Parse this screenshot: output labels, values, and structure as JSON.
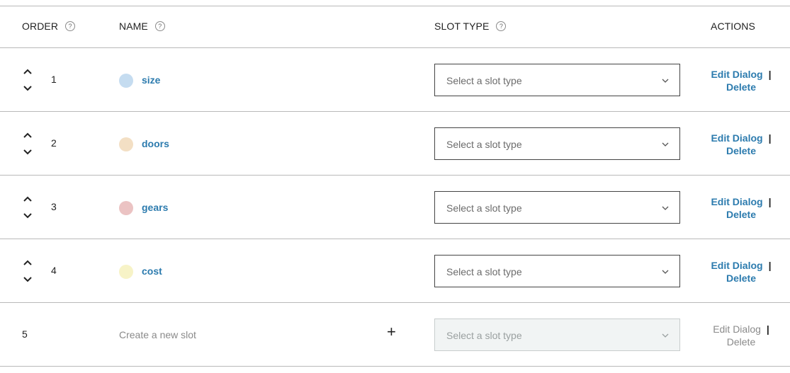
{
  "header": {
    "order": "ORDER",
    "name": "NAME",
    "slot_type": "SLOT TYPE",
    "actions": "ACTIONS",
    "help_glyph": "?"
  },
  "rows": [
    {
      "order": "1",
      "name": "size",
      "dot_color": "#c5dcf0",
      "slot_type_placeholder": "Select a slot type",
      "edit": "Edit Dialog",
      "separator": "|",
      "delete": "Delete"
    },
    {
      "order": "2",
      "name": "doors",
      "dot_color": "#f3dfc4",
      "slot_type_placeholder": "Select a slot type",
      "edit": "Edit Dialog",
      "separator": "|",
      "delete": "Delete"
    },
    {
      "order": "3",
      "name": "gears",
      "dot_color": "#ebc3c3",
      "slot_type_placeholder": "Select a slot type",
      "edit": "Edit Dialog",
      "separator": "|",
      "delete": "Delete"
    },
    {
      "order": "4",
      "name": "cost",
      "dot_color": "#f7f3c7",
      "slot_type_placeholder": "Select a slot type",
      "edit": "Edit Dialog",
      "separator": "|",
      "delete": "Delete"
    }
  ],
  "new_row": {
    "order": "5",
    "placeholder": "Create a new slot",
    "add_glyph": "+",
    "slot_type_placeholder": "Select a slot type",
    "edit": "Edit Dialog",
    "separator": "|",
    "delete": "Delete"
  },
  "colors": {
    "link": "#2c7bae",
    "divider": "#b9b9b9"
  }
}
